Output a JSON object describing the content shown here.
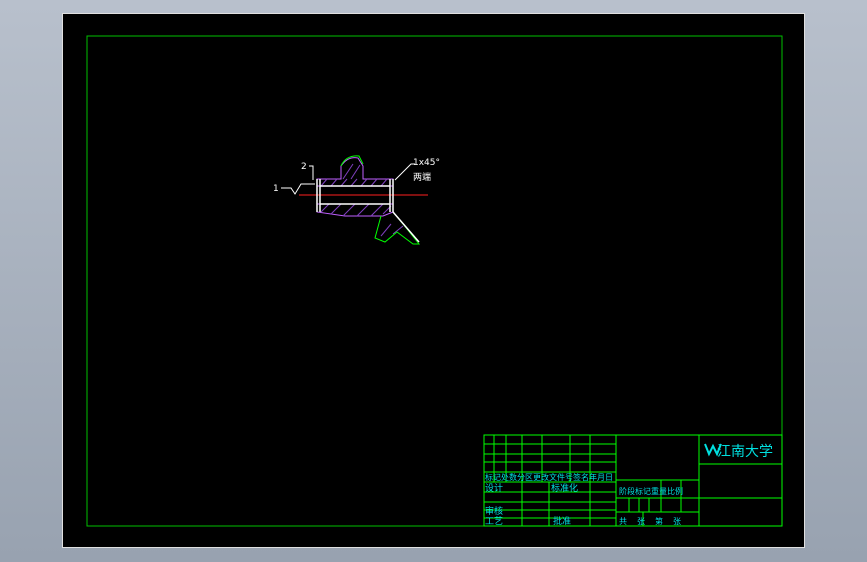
{
  "drawing": {
    "part": {
      "chamfer_note": "1x45°",
      "chamfer_note2": "两端",
      "roughness_top": "2",
      "roughness_left": "1"
    },
    "title_block": {
      "school": "江南大学",
      "row_labels": "标记处数分区更改文件号签名年月日",
      "design_label": "设计",
      "standard_label": "标准化",
      "stage_labels": "阶段标记重量比例",
      "review_label": "审核",
      "process_label": "工艺",
      "approve_label": "批准",
      "sheets_label": "共张第张"
    },
    "colors": {
      "frame": "#00c000",
      "table": "#00ff00",
      "text": "#00e0e0",
      "hatch": "#8040c0",
      "center": "#ff2020",
      "line": "#ffffff"
    }
  }
}
